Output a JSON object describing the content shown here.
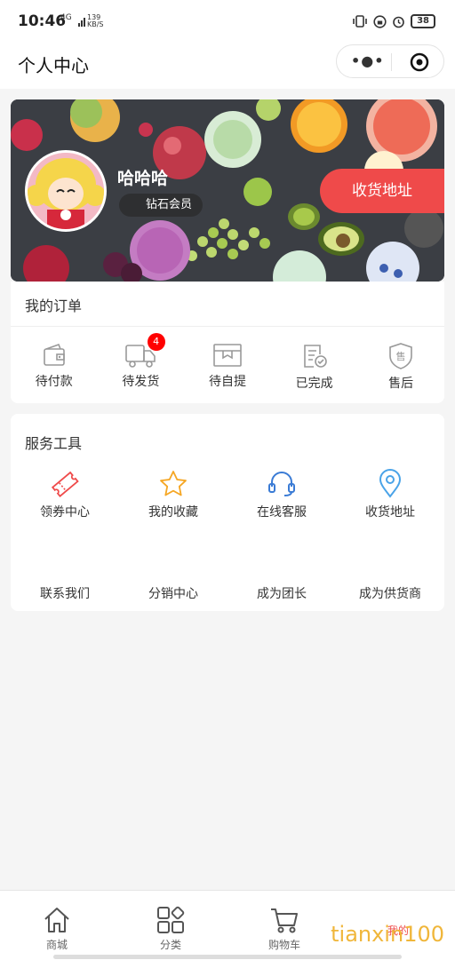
{
  "status": {
    "time": "10:46",
    "network": "4G",
    "speed_value": "139",
    "speed_unit": "KB/S",
    "battery": "38"
  },
  "nav": {
    "title": "个人中心"
  },
  "profile": {
    "username": "哈哈哈",
    "member_level": "钻石会员",
    "address_button": "收货地址"
  },
  "orders": {
    "title": "我的订单",
    "items": [
      {
        "label": "待付款",
        "icon": "wallet-icon"
      },
      {
        "label": "待发货",
        "icon": "truck-icon",
        "badge": "4"
      },
      {
        "label": "待自提",
        "icon": "box-icon"
      },
      {
        "label": "已完成",
        "icon": "check-document-icon"
      },
      {
        "label": "售后",
        "icon": "shield-after-sale-icon"
      }
    ]
  },
  "tools": {
    "title": "服务工具",
    "items": [
      {
        "label": "领券中心",
        "icon": "coupon-icon"
      },
      {
        "label": "我的收藏",
        "icon": "star-icon"
      },
      {
        "label": "在线客服",
        "icon": "headset-icon"
      },
      {
        "label": "收货地址",
        "icon": "location-pin-icon"
      },
      {
        "label": "联系我们"
      },
      {
        "label": "分销中心"
      },
      {
        "label": "成为团长"
      },
      {
        "label": "成为供货商"
      }
    ]
  },
  "tabbar": {
    "items": [
      {
        "label": "商城",
        "icon": "home-icon"
      },
      {
        "label": "分类",
        "icon": "category-icon"
      },
      {
        "label": "购物车",
        "icon": "cart-icon"
      },
      {
        "label": "我的",
        "icon": "user-icon"
      }
    ]
  },
  "watermark": "tianxin100",
  "colors": {
    "accent": "#ef4a4a",
    "badge": "#ff0000",
    "background": "#f5f5f5"
  }
}
